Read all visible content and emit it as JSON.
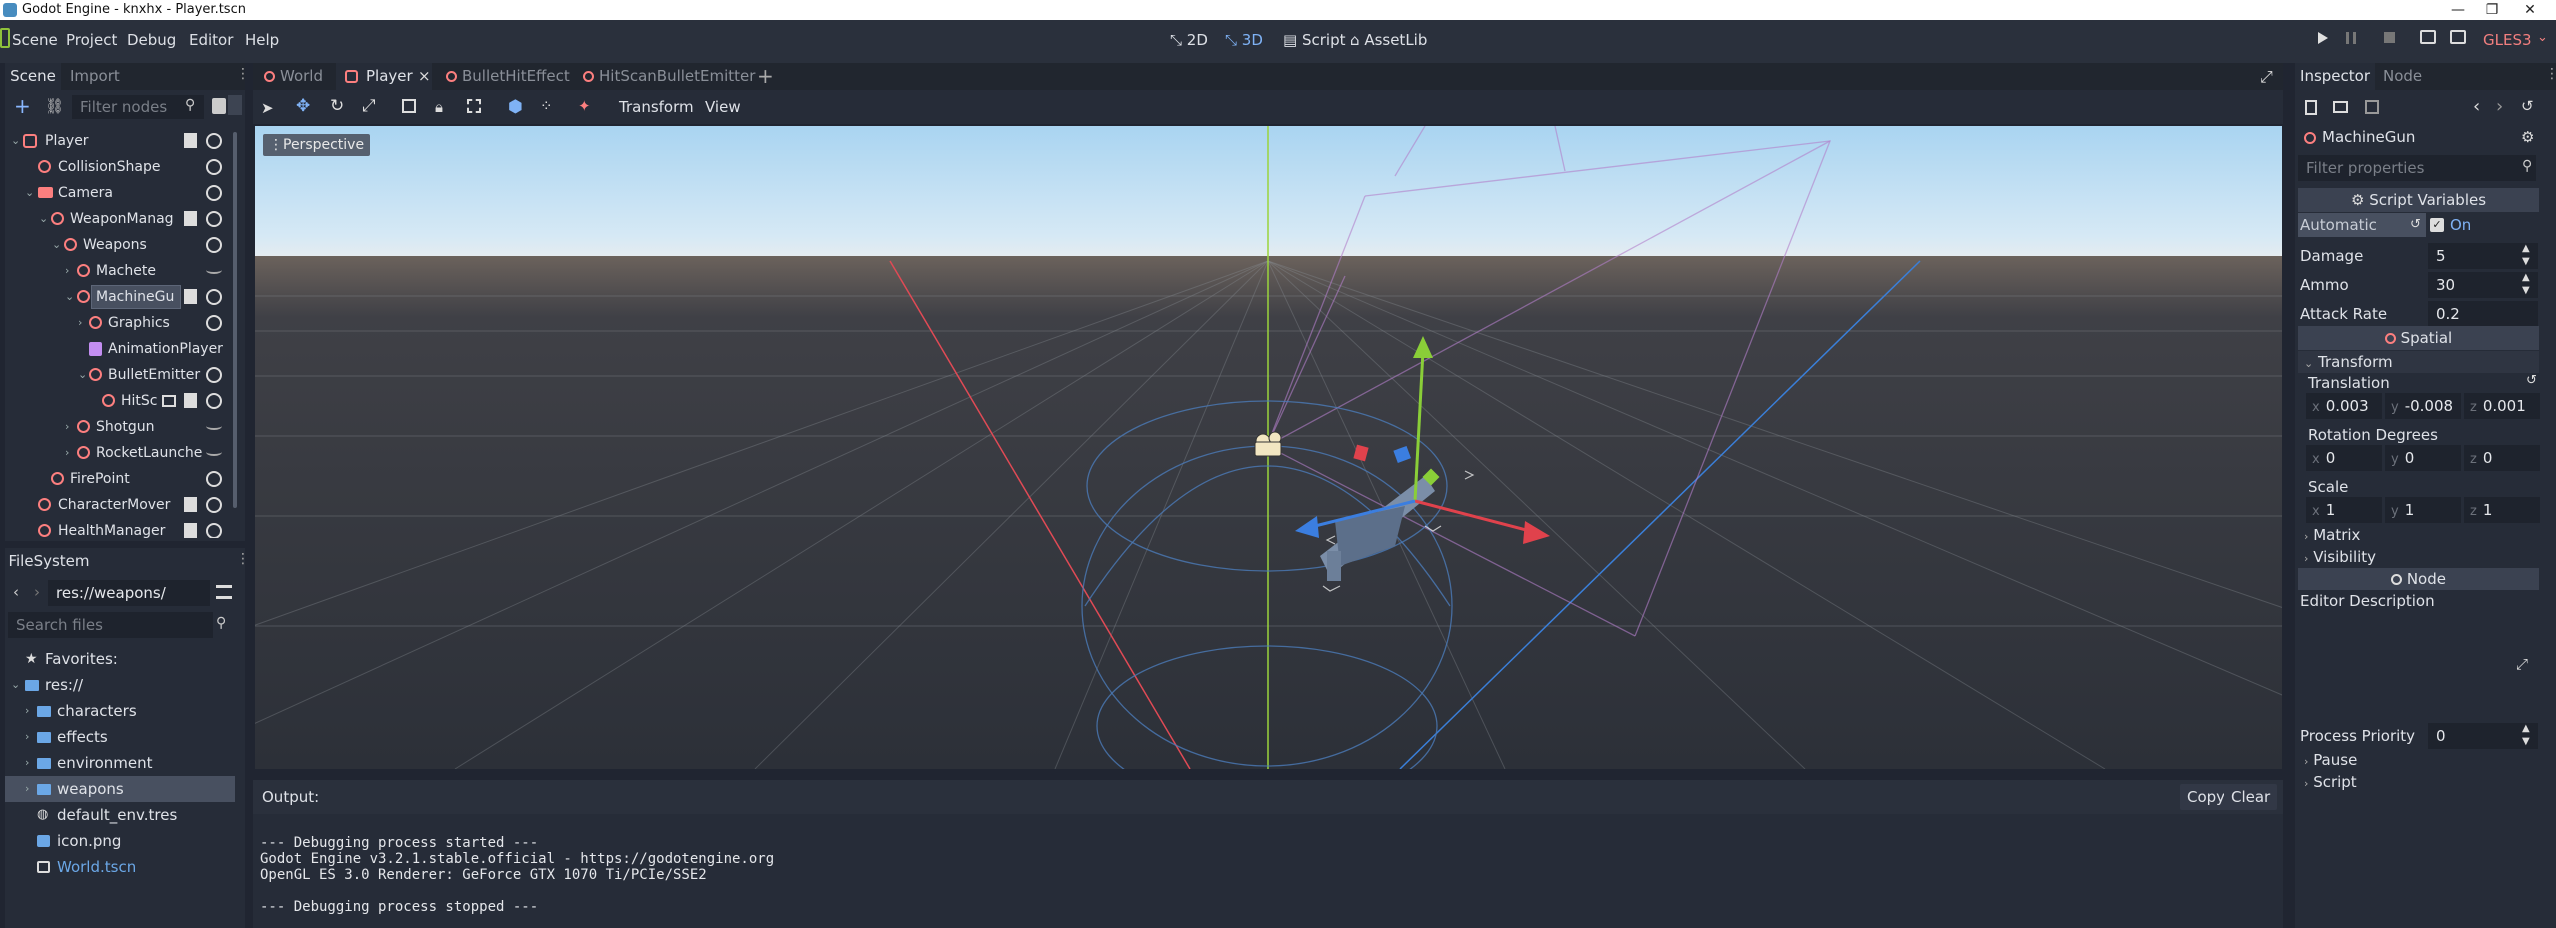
{
  "window": {
    "title": "Godot Engine - knxhx - Player.tscn"
  },
  "menubar": {
    "items": [
      "Scene",
      "Project",
      "Debug",
      "Editor",
      "Help"
    ],
    "modes": [
      "2D",
      "3D",
      "Script",
      "AssetLib"
    ],
    "renderer": "GLES3"
  },
  "scene_dock": {
    "tabs": [
      "Scene",
      "Import"
    ],
    "filter_placeholder": "Filter nodes",
    "nodes": [
      {
        "label": "Player"
      },
      {
        "label": "CollisionShape"
      },
      {
        "label": "Camera"
      },
      {
        "label": "WeaponManag"
      },
      {
        "label": "Weapons"
      },
      {
        "label": "Machete"
      },
      {
        "label": "MachineGu"
      },
      {
        "label": "Graphics"
      },
      {
        "label": "AnimationPlayer"
      },
      {
        "label": "BulletEmitter"
      },
      {
        "label": "HitSc"
      },
      {
        "label": "Shotgun"
      },
      {
        "label": "RocketLaunche"
      },
      {
        "label": "FirePoint"
      },
      {
        "label": "CharacterMover"
      },
      {
        "label": "HealthManager"
      }
    ]
  },
  "filesystem": {
    "tab": "FileSystem",
    "path": "res://weapons/",
    "search_placeholder": "Search files",
    "items": [
      {
        "label": "Favorites:"
      },
      {
        "label": "res://"
      },
      {
        "label": "characters"
      },
      {
        "label": "effects"
      },
      {
        "label": "environment"
      },
      {
        "label": "weapons"
      },
      {
        "label": "default_env.tres"
      },
      {
        "label": "icon.png"
      },
      {
        "label": "World.tscn"
      }
    ]
  },
  "editor_tabs": [
    "World",
    "Player",
    "BulletHitEffect",
    "HitScanBulletEmitter"
  ],
  "viewport_toolbar": {
    "transform": "Transform",
    "view": "View"
  },
  "viewport": {
    "label": "Perspective"
  },
  "output": {
    "title": "Output:",
    "copy": "Copy",
    "clear": "Clear",
    "lines": [
      "--- Debugging process started ---",
      "Godot Engine v3.2.1.stable.official - https://godotengine.org",
      "OpenGL ES 3.0 Renderer: GeForce GTX 1070 Ti/PCIe/SSE2",
      "",
      "--- Debugging process stopped ---"
    ]
  },
  "inspector": {
    "tabs": [
      "Inspector",
      "Node"
    ],
    "node_name": "MachineGun",
    "filter_placeholder": "Filter properties",
    "script_variables": "Script Variables",
    "automatic_label": "Automatic",
    "automatic_value": "On",
    "damage_label": "Damage",
    "damage_value": "5",
    "ammo_label": "Ammo",
    "ammo_value": "30",
    "attack_rate_label": "Attack Rate",
    "attack_rate_value": "0.2",
    "spatial": "Spatial",
    "transform": "Transform",
    "translation_label": "Translation",
    "translation": {
      "x": "0.003",
      "y": "-0.008",
      "z": "0.001"
    },
    "rotation_label": "Rotation Degrees",
    "rotation": {
      "x": "0",
      "y": "0",
      "z": "0"
    },
    "scale_label": "Scale",
    "scale": {
      "x": "1",
      "y": "1",
      "z": "1"
    },
    "matrix": "Matrix",
    "visibility": "Visibility",
    "node_section": "Node",
    "editor_description": "Editor Description",
    "process_priority_label": "Process Priority",
    "process_priority_value": "0",
    "pause": "Pause",
    "script": "Script",
    "axis_x": "x",
    "axis_y": "y",
    "axis_z": "z"
  },
  "colors": {
    "accent": "#699ce8",
    "node_red": "#fc7f7f",
    "background": "#202531",
    "panel": "#262c38"
  }
}
